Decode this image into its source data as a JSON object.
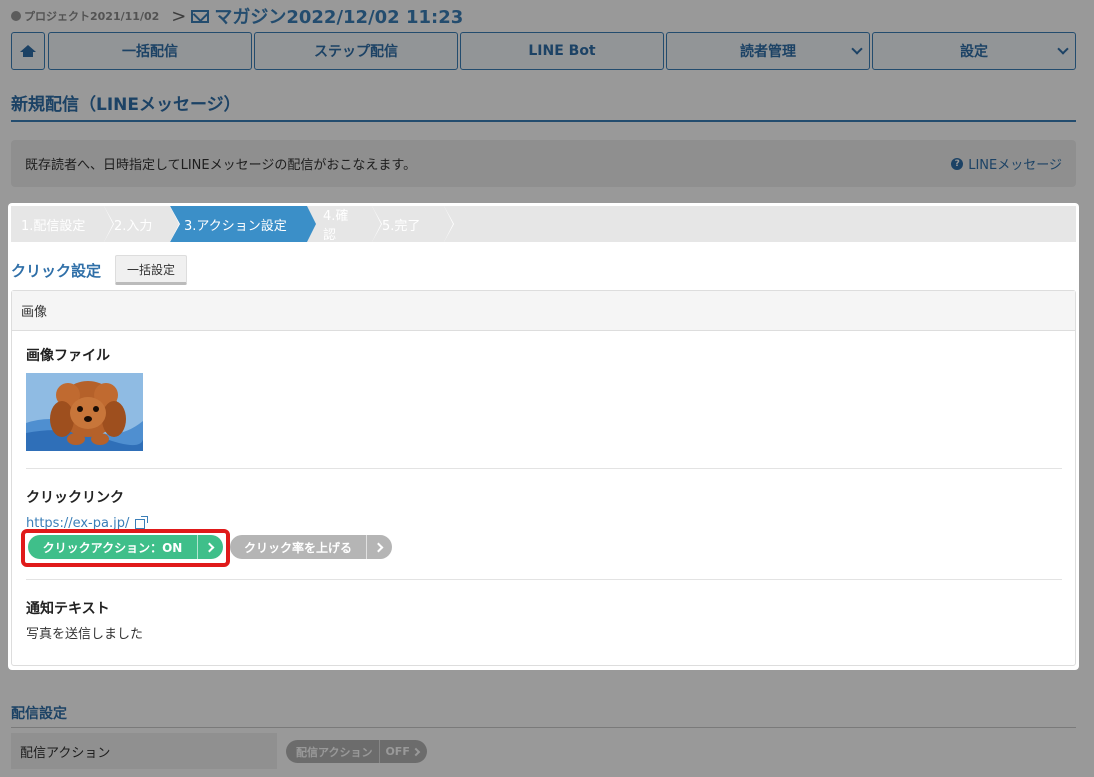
{
  "breadcrumb": {
    "project": "プロジェクト2021/11/02",
    "separator": ">",
    "current": "マガジン2022/12/02 11:23"
  },
  "nav": {
    "items": [
      {
        "label": "一括配信"
      },
      {
        "label": "ステップ配信"
      },
      {
        "label": "LINE Bot"
      },
      {
        "label": "読者管理"
      },
      {
        "label": "設定"
      }
    ]
  },
  "page": {
    "title": "新規配信（LINEメッセージ）",
    "description": "既存読者へ、日時指定してLINEメッセージの配信がおこなえます。",
    "help_link": "LINEメッセージ"
  },
  "steps": [
    {
      "label": "1.配信設定"
    },
    {
      "label": "2.入力"
    },
    {
      "label": "3.アクション設定",
      "active": true
    },
    {
      "label": "4.確認"
    },
    {
      "label": "5.完了"
    }
  ],
  "click_settings": {
    "title": "クリック設定",
    "bulk_button": "一括設定",
    "card_header": "画像",
    "image_label": "画像ファイル",
    "link_label": "クリックリンク",
    "link_url": "https://ex-pa.jp/",
    "click_action_button": "クリックアクション：ON",
    "click_rate_button": "クリック率を上げる",
    "notify_label": "通知テキスト",
    "notify_value": "写真を送信しました"
  },
  "delivery": {
    "title": "配信設定",
    "row_label": "配信アクション",
    "toggle_label": "配信アクション",
    "toggle_state": "OFF"
  },
  "colors": {
    "accent": "#3b7fb8",
    "active_step": "#3b8fc8",
    "on_button": "#3fbf8a",
    "highlight": "#e01a1a"
  }
}
